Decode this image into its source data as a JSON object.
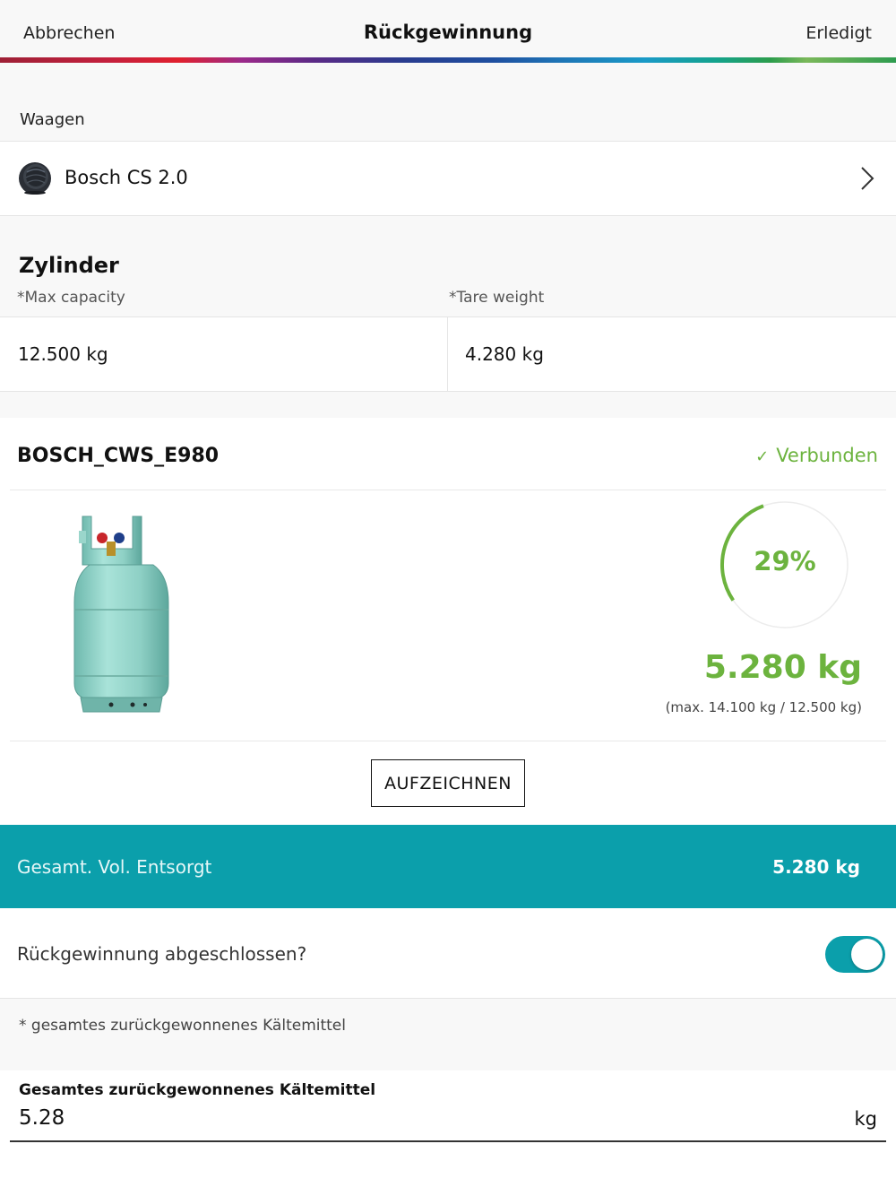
{
  "nav": {
    "cancel_label": "Abbrechen",
    "title": "Rückgewinnung",
    "done_label": "Erledigt"
  },
  "scales": {
    "section_label": "Waagen",
    "device_name": "Bosch CS 2.0",
    "icon": "scale-device-icon"
  },
  "cylinder": {
    "heading": "Zylinder",
    "max_capacity_label": "*Max capacity",
    "tare_weight_label": "*Tare weight",
    "max_capacity_value": "12.500 kg",
    "tare_weight_value": "4.280 kg"
  },
  "device": {
    "name": "BOSCH_CWS_E980",
    "status_icon": "checkmark-icon",
    "status_label": "Verbunden",
    "fill_percent_label": "29%",
    "fill_fraction": 0.29,
    "weight": "5.280 kg",
    "weight_detail": "(max. 14.100 kg / 12.500 kg)",
    "record_button": "AUFZEICHNEN"
  },
  "total": {
    "label": "Gesamt. Vol. Entsorgt",
    "value": "5.280 kg"
  },
  "completion": {
    "label": "Rückgewinnung abgeschlossen?",
    "toggle_on": true
  },
  "note": "* gesamtes zurückgewonnenes Kältemittel",
  "refrigerant_input": {
    "title": "Gesamtes zurückgewonnenes Kältemittel",
    "value": "5.28",
    "unit": "kg"
  },
  "colors": {
    "accent_green": "#6cb33e",
    "teal": "#0b9fab"
  }
}
